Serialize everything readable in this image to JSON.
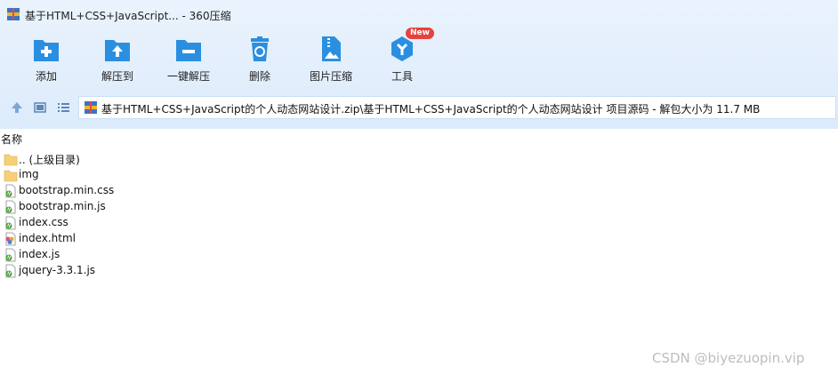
{
  "window": {
    "title": "基于HTML+CSS+JavaScript... - 360压缩"
  },
  "toolbar": {
    "items": [
      {
        "label": "添加",
        "icon": "add-icon"
      },
      {
        "label": "解压到",
        "icon": "extract-to-icon"
      },
      {
        "label": "一键解压",
        "icon": "one-click-extract-icon"
      },
      {
        "label": "删除",
        "icon": "delete-icon"
      },
      {
        "label": "图片压缩",
        "icon": "image-compress-icon"
      },
      {
        "label": "工具",
        "icon": "tools-icon",
        "badge": "New"
      }
    ]
  },
  "address": {
    "path": "基于HTML+CSS+JavaScript的个人动态网站设计.zip\\基于HTML+CSS+JavaScript的个人动态网站设计 项目源码 - 解包大小为 11.7 MB"
  },
  "filelist": {
    "column_name": "名称",
    "items": [
      {
        "name": ".. (上级目录)",
        "type": "parent"
      },
      {
        "name": "img",
        "type": "folder"
      },
      {
        "name": "bootstrap.min.css",
        "type": "script"
      },
      {
        "name": "bootstrap.min.js",
        "type": "script"
      },
      {
        "name": "index.css",
        "type": "script"
      },
      {
        "name": "index.html",
        "type": "html"
      },
      {
        "name": "index.js",
        "type": "script"
      },
      {
        "name": "jquery-3.3.1.js",
        "type": "script"
      }
    ]
  },
  "watermark": "CSDN @biyezuopin.vip",
  "colors": {
    "toolbar_blue": "#2a8fe0",
    "badge_red": "#e8413c",
    "header_bg": "#dcebfb"
  }
}
